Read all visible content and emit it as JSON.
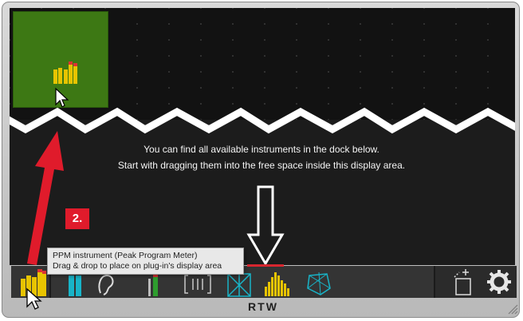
{
  "instructions": {
    "line1": "You can find all available instruments in the dock below.",
    "line2": "Start with dragging them into the free space inside this display area."
  },
  "step_badge": "2.",
  "tooltip": {
    "line1": "PPM instrument (Peak Program Meter)",
    "line2": "Drag & drop to place on plug-in's display area"
  },
  "footer": {
    "logo": "RTW"
  },
  "dock": {
    "items": [
      {
        "name": "ppm-instrument",
        "icon": "ppm-bars-icon"
      },
      {
        "name": "loudness-instrument",
        "icon": "loudness-icon"
      },
      {
        "name": "true-peak-instrument",
        "icon": "tp-bars-icon"
      },
      {
        "name": "ear-instrument",
        "icon": "ear-icon"
      },
      {
        "name": "green-bar-instrument",
        "icon": "single-bar-icon"
      },
      {
        "name": "channel-instrument",
        "icon": "brackets-icon"
      },
      {
        "name": "vectorscope-instrument",
        "icon": "vectorscope-icon"
      },
      {
        "name": "spectrum-instrument",
        "icon": "spectrum-icon"
      },
      {
        "name": "surround-instrument",
        "icon": "surround-icon"
      }
    ],
    "right": [
      {
        "name": "new-window",
        "icon": "add-window-icon"
      },
      {
        "name": "settings",
        "icon": "gear-icon"
      }
    ]
  },
  "colors": {
    "accent_red": "#e01b2b",
    "green_area": "#3d7814",
    "bar_yellow": "#e8c400"
  }
}
